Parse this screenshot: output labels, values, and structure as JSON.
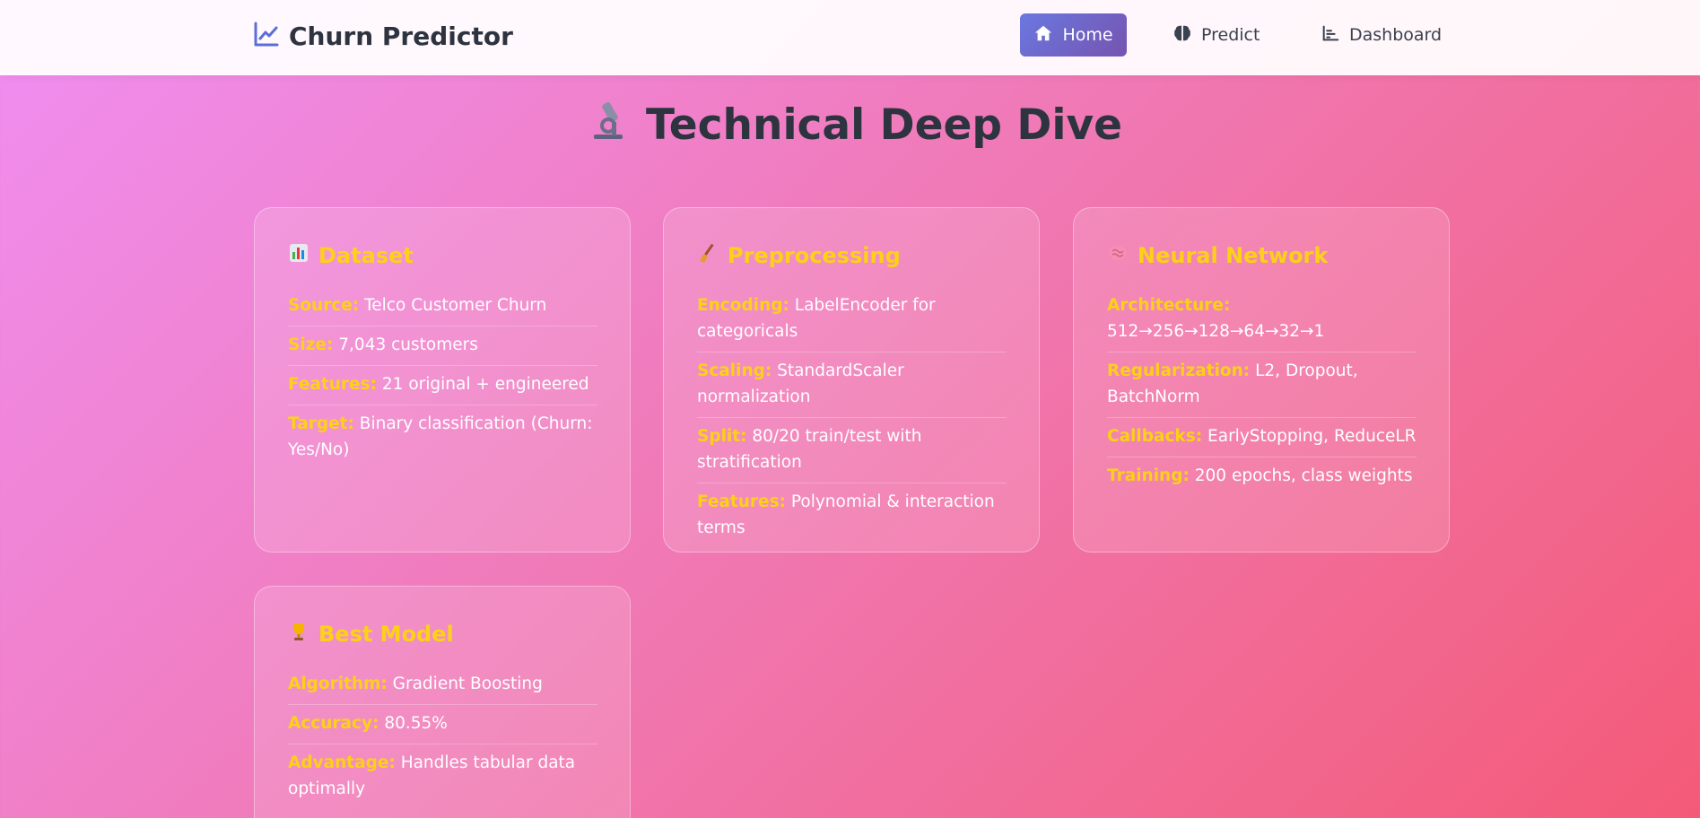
{
  "nav": {
    "brand": "Churn Predictor",
    "items": [
      {
        "label": "Home",
        "icon": "home-icon",
        "active": true
      },
      {
        "label": "Predict",
        "icon": "brain-icon",
        "active": false
      },
      {
        "label": "Dashboard",
        "icon": "bar-chart-icon",
        "active": false
      }
    ]
  },
  "page": {
    "title": "Technical Deep Dive",
    "title_icon": "microscope-icon"
  },
  "cards": [
    {
      "title": "Dataset",
      "icon": "bar-chart-emoji-icon",
      "rows": [
        {
          "label": "Source:",
          "value": "Telco Customer Churn"
        },
        {
          "label": "Size:",
          "value": "7,043 customers"
        },
        {
          "label": "Features:",
          "value": "21 original + engineered"
        },
        {
          "label": "Target:",
          "value": "Binary classification (Churn: Yes/No)"
        }
      ]
    },
    {
      "title": "Preprocessing",
      "icon": "broom-icon",
      "rows": [
        {
          "label": "Encoding:",
          "value": "LabelEncoder for categoricals"
        },
        {
          "label": "Scaling:",
          "value": "StandardScaler normalization"
        },
        {
          "label": "Split:",
          "value": "80/20 train/test with stratification"
        },
        {
          "label": "Features:",
          "value": "Polynomial & interaction terms"
        }
      ]
    },
    {
      "title": "Neural Network",
      "icon": "brain-emoji-icon",
      "rows": [
        {
          "label": "Architecture:",
          "value": "512→256→128→64→32→1"
        },
        {
          "label": "Regularization:",
          "value": "L2, Dropout, BatchNorm"
        },
        {
          "label": "Callbacks:",
          "value": "EarlyStopping, ReduceLR"
        },
        {
          "label": "Training:",
          "value": "200 epochs, class weights"
        }
      ]
    },
    {
      "title": "Best Model",
      "icon": "trophy-icon",
      "rows": [
        {
          "label": "Algorithm:",
          "value": "Gradient Boosting"
        },
        {
          "label": "Accuracy:",
          "value": "80.55%"
        },
        {
          "label": "Advantage:",
          "value": "Handles tabular data optimally"
        }
      ]
    }
  ],
  "colors": {
    "accent": "#fcd117",
    "nav_active_start": "#6a78e0",
    "nav_active_end": "#7654b0",
    "text_dark": "#2d3440"
  }
}
